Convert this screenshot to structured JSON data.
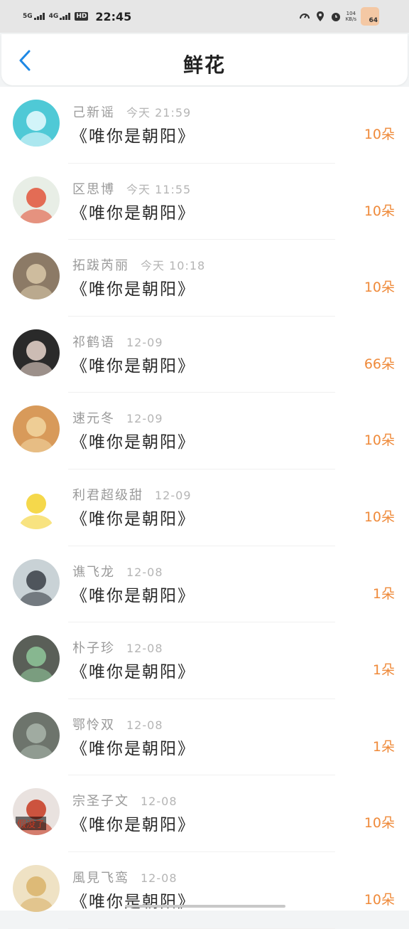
{
  "status_bar": {
    "net1": "5G",
    "net2": "4G",
    "hd": "HD",
    "time": "22:45",
    "speed_value": "104",
    "speed_unit": "KB/s",
    "battery": "64"
  },
  "header": {
    "title": "鲜花"
  },
  "items": [
    {
      "name": "己新谣",
      "time": "今天 21:59",
      "work": "《唯你是朝阳》",
      "count": "10朵",
      "avatar": {
        "bg": "#4fc9d6",
        "fg": "#e9fbff"
      }
    },
    {
      "name": "区思博",
      "time": "今天 11:55",
      "work": "《唯你是朝阳》",
      "count": "10朵",
      "avatar": {
        "bg": "#e8eee6",
        "fg": "#e2553b"
      }
    },
    {
      "name": "拓跋芮丽",
      "time": "今天 10:18",
      "work": "《唯你是朝阳》",
      "count": "10朵",
      "avatar": {
        "bg": "#8c7a66",
        "fg": "#d9c8a8"
      }
    },
    {
      "name": "祁鹤语",
      "time": "12-09",
      "work": "《唯你是朝阳》",
      "count": "66朵",
      "avatar": {
        "bg": "#2a2a2a",
        "fg": "#e9d6cc"
      }
    },
    {
      "name": "速元冬",
      "time": "12-09",
      "work": "《唯你是朝阳》",
      "count": "10朵",
      "avatar": {
        "bg": "#d89a5a",
        "fg": "#f2d6a0"
      }
    },
    {
      "name": "利君超级甜",
      "time": "12-09",
      "work": "《唯你是朝阳》",
      "count": "10朵",
      "avatar": {
        "bg": "#ffffff",
        "fg": "#f3d12c"
      }
    },
    {
      "name": "谯飞龙",
      "time": "12-08",
      "work": "《唯你是朝阳》",
      "count": "1朵",
      "avatar": {
        "bg": "#c9d2d6",
        "fg": "#3a3f46"
      }
    },
    {
      "name": "朴子珍",
      "time": "12-08",
      "work": "《唯你是朝阳》",
      "count": "1朵",
      "avatar": {
        "bg": "#5a5f58",
        "fg": "#8fc79a"
      }
    },
    {
      "name": "鄂怜双",
      "time": "12-08",
      "work": "《唯你是朝阳》",
      "count": "1朵",
      "avatar": {
        "bg": "#6d746c",
        "fg": "#a9b5aa"
      }
    },
    {
      "name": "宗圣子文",
      "time": "12-08",
      "work": "《唯你是朝阳》",
      "count": "10朵",
      "avatar": {
        "bg": "#e9e2df",
        "fg": "#c73a22",
        "text": "假没了"
      }
    },
    {
      "name": "風見飞鸾",
      "time": "12-08",
      "work": "《唯你是朝阳》",
      "count": "10朵",
      "avatar": {
        "bg": "#efe2c4",
        "fg": "#d9b36a"
      }
    }
  ],
  "colors": {
    "accent": "#1e88e5",
    "count": "#ef8a3a",
    "name": "#9a9a9a"
  }
}
